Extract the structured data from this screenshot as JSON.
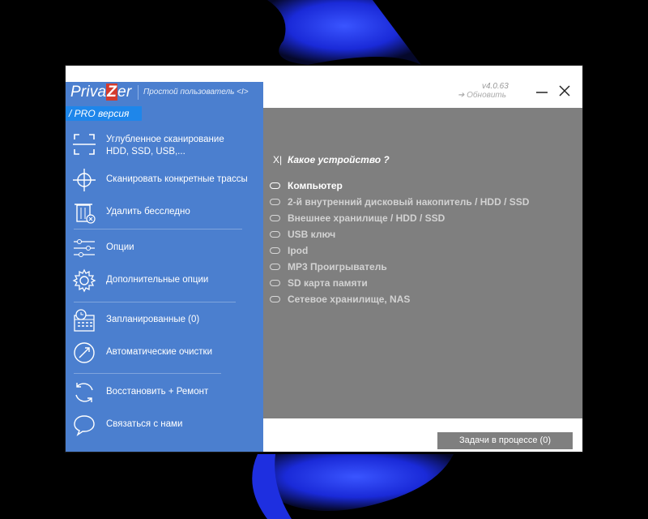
{
  "app": {
    "logo_part1": "Priva",
    "logo_z": "Z",
    "logo_part2": "er",
    "user_mode": "Простой пользователь <I>",
    "pro_version": "/ PRO версия",
    "version": "v4.0.63",
    "update": "➔ Обновить"
  },
  "sidebar": {
    "items": [
      {
        "icon": "scan-icon",
        "label_line1": "Углубленное сканирование",
        "label_line2": "HDD, SSD, USB,..."
      },
      {
        "icon": "crosshair-icon",
        "label": "Сканировать конкретные трассы"
      },
      {
        "icon": "trash-icon",
        "label": "Удалить бесследно"
      },
      {
        "icon": "sliders-icon",
        "label": "Опции"
      },
      {
        "icon": "gear-icon",
        "label": "Дополнительные опции"
      },
      {
        "icon": "calendar-clock-icon",
        "label": "Запланированные (0)"
      },
      {
        "icon": "auto-clean-icon",
        "label": "Автоматические очистки"
      },
      {
        "icon": "restore-icon",
        "label": "Восстановить + Ремонт"
      },
      {
        "icon": "chat-icon",
        "label": "Связаться с нами"
      }
    ]
  },
  "main": {
    "question_mark": "X|",
    "question": "Какое устройство ?",
    "options": [
      "Компьютер",
      "2-й внутренний дисковый накопитель / HDD / SSD",
      "Внешнее хранилище  / HDD / SSD",
      "USB ключ",
      "Ipod",
      "MP3 Проигрыватель",
      "SD карта памяти",
      "Сетевое хранилище, NAS"
    ],
    "selected_index": 0
  },
  "footer": {
    "tasks_button": "Задачи в процессе (0)"
  },
  "colors": {
    "sidebar": "#4b7fcf",
    "pro_badge": "#1e86ea",
    "main_bg": "#7f7f7f",
    "logo_z": "#d43b2e"
  }
}
